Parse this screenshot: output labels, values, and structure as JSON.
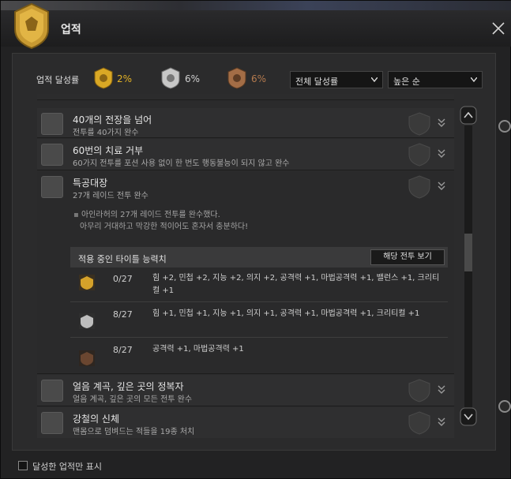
{
  "window": {
    "title": "업적",
    "close_icon": "close-icon"
  },
  "summary": {
    "label": "업적 달성률",
    "gold": {
      "icon": "gold-medal-icon",
      "value": "2%",
      "color": "#e4b224"
    },
    "silver": {
      "icon": "silver-medal-icon",
      "value": "6%",
      "color": "#d0d0d0"
    },
    "bronze": {
      "icon": "bronze-medal-icon",
      "value": "6%",
      "color": "#b47a4e"
    },
    "filter_select": "전체 달성률",
    "sort_select": "높은 순"
  },
  "rows": [
    {
      "title": "40개의 전장을 넘어",
      "subtitle": "전투를 40가지 완수"
    },
    {
      "title": "60번의 치료 거부",
      "subtitle": "60가지 전투를 포션 사용 없이 한 번도 행동불능이 되지 않고 완수"
    },
    {
      "title": "특공대장",
      "subtitle": "27개 레이드 전투 완수"
    },
    {
      "title": "얼음 계곡, 깊은 곳의 정복자",
      "subtitle": "얼음 계곡, 깊은 곳의 모든 전투 완수"
    },
    {
      "title": "강철의 신체",
      "subtitle": "맨몸으로 덤벼드는 적들을 19종 처치"
    }
  ],
  "detail": {
    "quote_line1": "아인라허의 27개 레이드 전투를 완수했다.",
    "quote_line2": "아무리 거대하고 막강한 적이어도 혼자서 충분하다!",
    "titles_header": "적용 중인 타이틀 능력치",
    "view_button": "해당 전투 보기",
    "tiers": [
      {
        "icon": "gold-tier-icon",
        "count": "0/27",
        "desc": "힘 +2, 민첩 +2, 지능 +2, 의지 +2, 공격력 +1, 마법공격력 +1, 밸런스 +1, 크리티컬 +1"
      },
      {
        "icon": "silver-tier-icon",
        "count": "8/27",
        "desc": "힘 +1, 민첩 +1, 지능 +1, 의지 +1, 공격력 +1, 마법공격력 +1, 크리티컬 +1"
      },
      {
        "icon": "bronze-tier-icon",
        "count": "8/27",
        "desc": "공격력 +1, 마법공격력 +1"
      }
    ]
  },
  "footer": {
    "checkbox_label": "달성한 업적만 표시",
    "checked": false
  }
}
